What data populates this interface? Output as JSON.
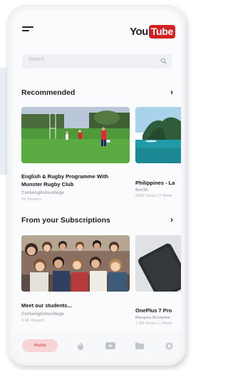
{
  "header": {
    "logo_you": "You",
    "logo_tube": "Tube"
  },
  "search": {
    "placeholder": "Search"
  },
  "sections": {
    "recommended": {
      "title": "Recommended"
    },
    "subscriptions": {
      "title": "From your Subscriptions"
    }
  },
  "recommended": [
    {
      "title_line1": "English & Rugby Programme With",
      "title_line2": "Munster Rugby Club",
      "channel": "Corkenglishcollege",
      "views": "1K Viewers"
    },
    {
      "title": "Philippines - La",
      "channel": "BonTK",
      "views": "500K Views | 2 Week"
    }
  ],
  "subscriptions": [
    {
      "title": "Meet our students...",
      "channel": "Corkenglishcollege",
      "views": "4.8K Viewers"
    },
    {
      "title": "OnePlus 7 Pro",
      "channel": "Marques Brownlee",
      "views": "1.2M Views | 1 Week"
    }
  ],
  "tabbar": {
    "home_label": "Home"
  },
  "colors": {
    "accent": "#d42020",
    "home_pill": "#f8d4d6",
    "home_text": "#d23b45"
  },
  "icons": [
    "menu-icon",
    "search-icon",
    "chevron-right-icon",
    "fire-icon",
    "play-icon",
    "folder-icon",
    "gear-icon"
  ]
}
